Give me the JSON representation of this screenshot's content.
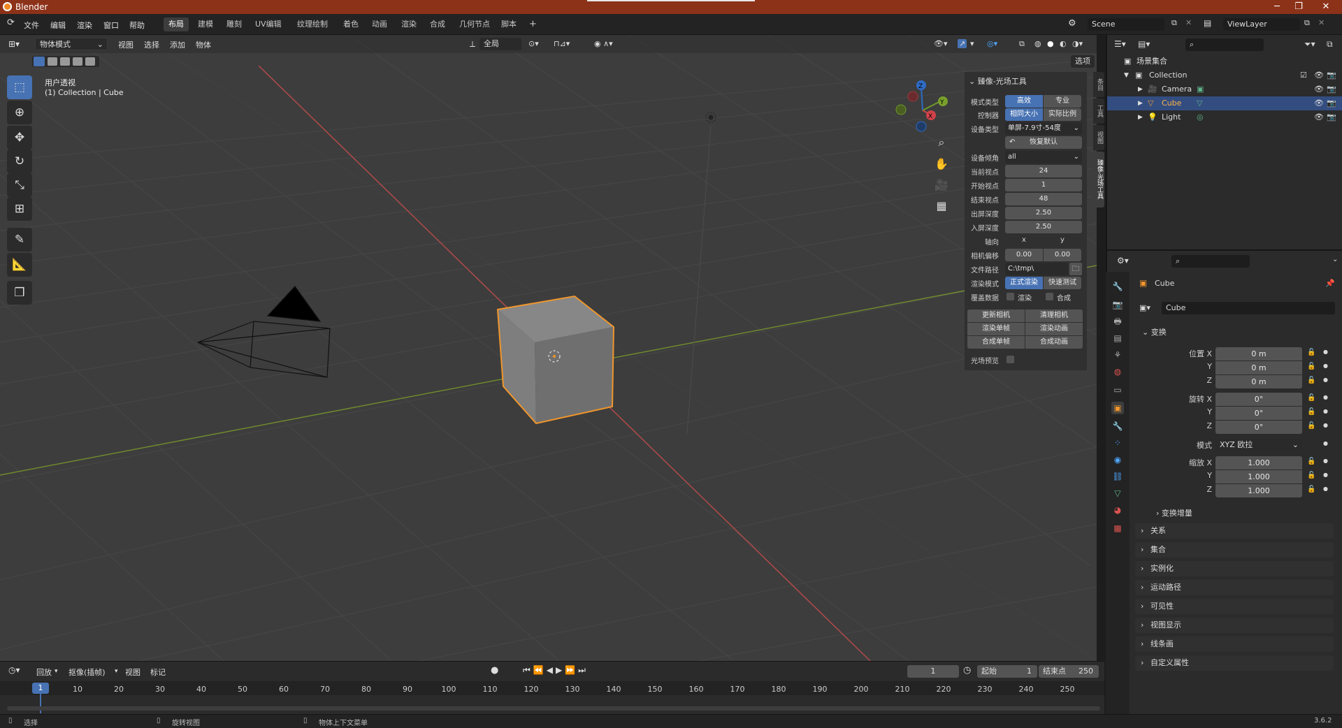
{
  "window": {
    "title": "Blender",
    "minimize": "─",
    "maximize": "❐",
    "close": "✕"
  },
  "menus": [
    "文件",
    "编辑",
    "渲染",
    "窗口",
    "帮助"
  ],
  "workspaces": [
    "布局",
    "建模",
    "雕刻",
    "UV编辑",
    "纹理绘制",
    "着色",
    "动画",
    "渲染",
    "合成",
    "几何节点",
    "脚本"
  ],
  "workspace_add": "+",
  "scene": {
    "name": "Scene",
    "view_layer": "ViewLayer"
  },
  "viewport_header": {
    "mode": "物体模式",
    "menus": [
      "视图",
      "选择",
      "添加",
      "物体"
    ],
    "transform_orientation": "全局",
    "options": "选项"
  },
  "viewport": {
    "view_name": "用户透视",
    "collection_info": "(1) Collection | Cube",
    "gizmo": {
      "x": "X",
      "y": "Y",
      "z": "Z"
    }
  },
  "npanel": {
    "title": "臻像-光场工具",
    "mode_type": {
      "label": "模式类型",
      "options": [
        "高效",
        "专业"
      ],
      "selected": 0
    },
    "controller": {
      "label": "控制器",
      "options": [
        "相同大小",
        "实际比例"
      ],
      "selected": 0
    },
    "device_type": {
      "label": "设备类型",
      "value": "单屏-7.9寸-54度"
    },
    "reset": "恢复默认",
    "device_tilt": {
      "label": "设备倾角",
      "value": "all"
    },
    "fields": [
      {
        "label": "当前视点",
        "value": "24"
      },
      {
        "label": "开始视点",
        "value": "1"
      },
      {
        "label": "结束视点",
        "value": "48"
      },
      {
        "label": "出屏深度",
        "value": "2.50"
      },
      {
        "label": "入屏深度",
        "value": "2.50"
      }
    ],
    "axis": {
      "label": "轴向",
      "x": "x",
      "y": "y"
    },
    "camera_offset": {
      "label": "相机偏移",
      "x": "0.00",
      "y": "0.00"
    },
    "file_path": {
      "label": "文件路径",
      "value": "C:\\tmp\\"
    },
    "render_mode": {
      "label": "渲染模式",
      "options": [
        "正式渲染",
        "快速测试"
      ],
      "selected": 0
    },
    "cover_data": {
      "label": "覆盖数据",
      "render": "渲染",
      "composite": "合成"
    },
    "buttons": [
      "更新相机",
      "清理相机",
      "渲染单帧",
      "渲染动画",
      "合成单帧",
      "合成动画"
    ],
    "preview": {
      "label": "光场预览"
    },
    "side_tabs": [
      "条目",
      "工具",
      "视图",
      "臻像-光场工具"
    ]
  },
  "timeline": {
    "menus": [
      "回放",
      "抠像(插帧)",
      "视图",
      "标记"
    ],
    "current_frame": "1",
    "start_label": "起始",
    "start": "1",
    "end_label": "结束点",
    "end": "250",
    "ticks": [
      "1",
      "10",
      "20",
      "30",
      "40",
      "50",
      "60",
      "70",
      "80",
      "90",
      "100",
      "110",
      "120",
      "130",
      "140",
      "150",
      "160",
      "170",
      "180",
      "190",
      "200",
      "210",
      "220",
      "230",
      "240",
      "250"
    ]
  },
  "status": {
    "select": "选择",
    "rotate": "旋转视图",
    "context": "物体上下文菜单",
    "version": "3.6.2"
  },
  "outliner": {
    "root": "场景集合",
    "collection": "Collection",
    "items": [
      "Camera",
      "Cube",
      "Light"
    ],
    "selected": "Cube"
  },
  "properties": {
    "object_name": "Cube",
    "data_name": "Cube",
    "transform_title": "变换",
    "location": {
      "label": "位置 X",
      "x": "0 m",
      "y": "0 m",
      "z": "0 m"
    },
    "rotation": {
      "label": "旋转 X",
      "x": "0°",
      "y": "0°",
      "z": "0°"
    },
    "mode": {
      "label": "模式",
      "value": "XYZ 欧拉"
    },
    "scale": {
      "label": "缩放 X",
      "x": "1.000",
      "y": "1.000",
      "z": "1.000"
    },
    "axis_y": "Y",
    "axis_z": "Z",
    "delta": "变换增量",
    "sections": [
      "关系",
      "集合",
      "实例化",
      "运动路径",
      "可见性",
      "视图显示",
      "线条画",
      "自定义属性"
    ]
  },
  "colors": {
    "accent": "#4772b3",
    "selection": "#f0962c",
    "titlebar": "#8c3219",
    "x_axis": "#c64848",
    "y_axis": "#7b9c2d"
  }
}
